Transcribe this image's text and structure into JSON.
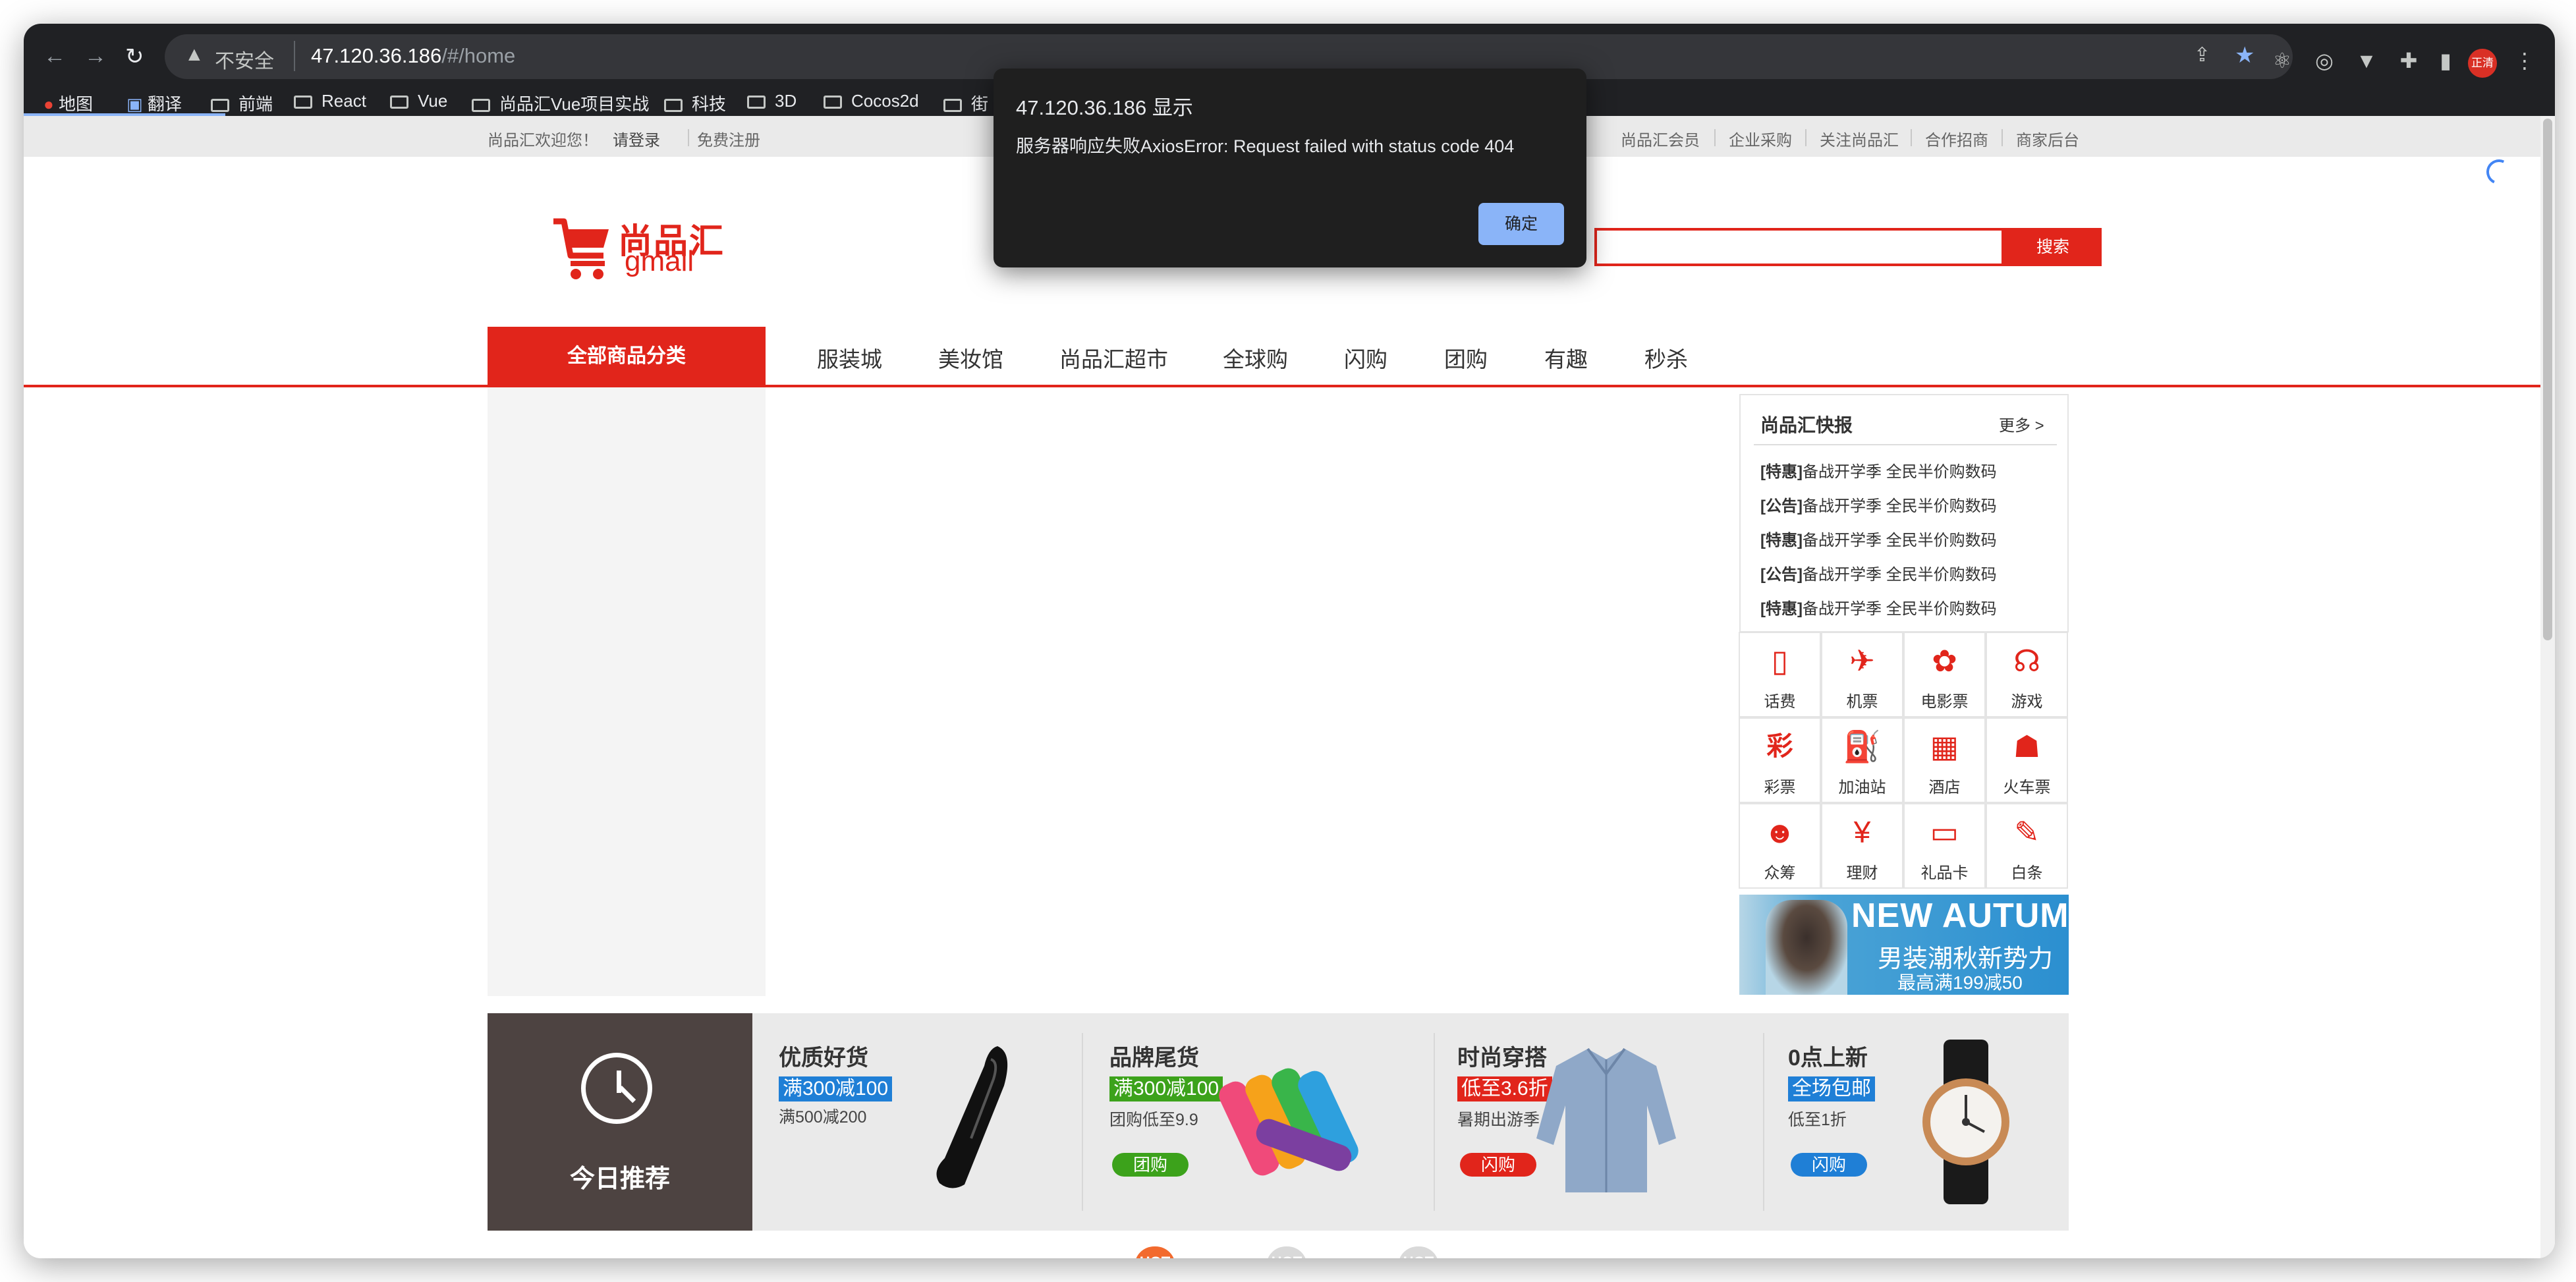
{
  "browser": {
    "address_warning": "▲",
    "address_insecure": "不安全",
    "url_host": "47.120.36.186",
    "url_path": "/#/home",
    "profile_label": "正清",
    "bookmarks": [
      "地图",
      "翻译",
      "前端",
      "React",
      "Vue",
      "尚品汇Vue项目实战",
      "科技",
      "3D",
      "Cocos2d",
      "街"
    ],
    "icons": [
      "back-icon",
      "forward-icon",
      "reload-icon",
      "share-icon",
      "star-icon",
      "extension-icon",
      "sidebar-icon"
    ]
  },
  "topbar": {
    "welcome": "尚品汇欢迎您！",
    "login": "请登录",
    "register": "免费注册",
    "links": [
      "尚品汇会员",
      "企业采购",
      "关注尚品汇",
      "合作招商",
      "商家后台"
    ]
  },
  "logo": {
    "cn": "尚品汇",
    "en": "gmall"
  },
  "search": {
    "button": "搜索",
    "value": ""
  },
  "nav": {
    "all": "全部商品分类",
    "items": [
      "服装城",
      "美妆馆",
      "尚品汇超市",
      "全球购",
      "闪购",
      "团购",
      "有趣",
      "秒杀"
    ]
  },
  "news": {
    "title": "尚品汇快报",
    "more": "更多 >",
    "items": [
      {
        "tag": "[特惠]",
        "text": "备战开学季 全民半价购数码"
      },
      {
        "tag": "[公告]",
        "text": "备战开学季 全民半价购数码"
      },
      {
        "tag": "[特惠]",
        "text": "备战开学季 全民半价购数码"
      },
      {
        "tag": "[公告]",
        "text": "备战开学季 全民半价购数码"
      },
      {
        "tag": "[特惠]",
        "text": "备战开学季 全民半价购数码"
      }
    ]
  },
  "services": [
    {
      "label": "话费",
      "icon": "phone-icon",
      "glyph": "▯"
    },
    {
      "label": "机票",
      "icon": "plane-icon",
      "glyph": "✈"
    },
    {
      "label": "电影票",
      "icon": "film-icon",
      "glyph": "✿"
    },
    {
      "label": "游戏",
      "icon": "gamepad-icon",
      "glyph": "☊"
    },
    {
      "label": "彩票",
      "icon": "lottery-icon",
      "glyph": "彩"
    },
    {
      "label": "加油站",
      "icon": "gas-station-icon",
      "glyph": "⛽"
    },
    {
      "label": "酒店",
      "icon": "hotel-icon",
      "glyph": "▦"
    },
    {
      "label": "火车票",
      "icon": "train-icon",
      "glyph": "☗"
    },
    {
      "label": "众筹",
      "icon": "crowdfunding-icon",
      "glyph": "☻"
    },
    {
      "label": "理财",
      "icon": "finance-icon",
      "glyph": "¥"
    },
    {
      "label": "礼品卡",
      "icon": "gift-card-icon",
      "glyph": "▭"
    },
    {
      "label": "白条",
      "icon": "credit-icon",
      "glyph": "✎"
    }
  ],
  "ad": {
    "title": "NEW AUTUMN",
    "subtitle": "男装潮秋新势力",
    "promo": "最高满199减50"
  },
  "today": {
    "label": "今日推荐",
    "items": [
      {
        "title": "优质好货",
        "tag": "满300减100",
        "tag_color": "#1f7fd6",
        "sub": "满500减200",
        "pill": "",
        "pill_color": ""
      },
      {
        "title": "品牌尾货",
        "tag": "满300减100",
        "tag_color": "#3ca21b",
        "sub": "团购低至9.9",
        "pill": "团购",
        "pill_color": "#3ca21b"
      },
      {
        "title": "时尚穿搭",
        "tag": "低至3.6折",
        "tag_color": "#e1251b",
        "sub": "暑期出游季",
        "pill": "闪购",
        "pill_color": "#e1251b"
      },
      {
        "title": "0点上新",
        "tag": "全场包邮",
        "tag_color": "#1f7fd6",
        "sub": "低至1折",
        "pill": "闪购",
        "pill_color": "#1f7fd6"
      }
    ]
  },
  "hot_label": "HOT",
  "dialog": {
    "title": "47.120.36.186 显示",
    "message": "服务器响应失败AxiosError: Request failed with status code 404",
    "ok": "确定"
  },
  "colors": {
    "brand": "#e1251b",
    "dialog_bg": "#1f1f1f",
    "dialog_button": "#8ab4f8"
  }
}
